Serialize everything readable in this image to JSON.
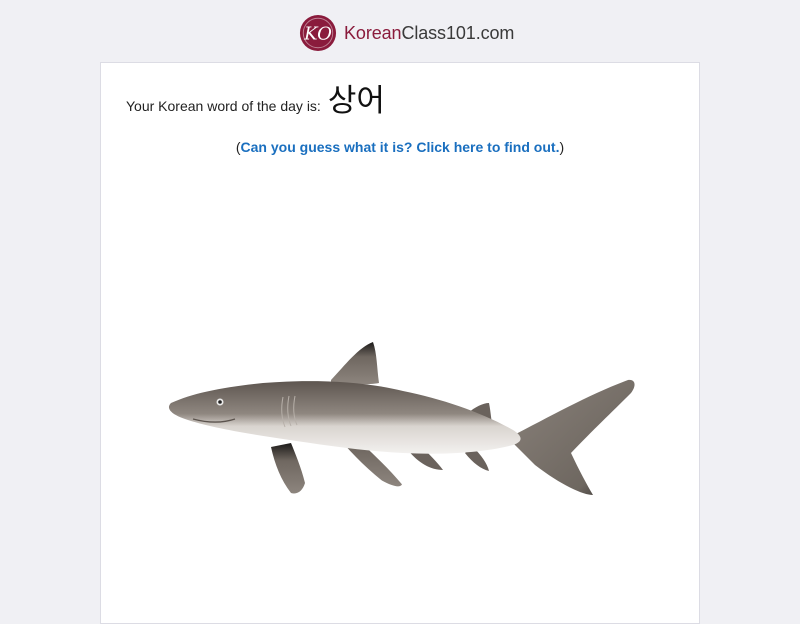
{
  "header": {
    "logo_text_a": "Korean",
    "logo_text_b": "Class101.com",
    "logo_badge_glyph": "KO",
    "brand_color": "#8a1b3c"
  },
  "card": {
    "intro_label": "Your Korean word of the day is:",
    "word": "상어",
    "hint_prefix": "(",
    "hint_link": "Can you guess what it is? Click here to find out.",
    "hint_suffix": ")",
    "link_color": "#1a6fbf"
  },
  "image": {
    "subject": "shark-illustration"
  }
}
